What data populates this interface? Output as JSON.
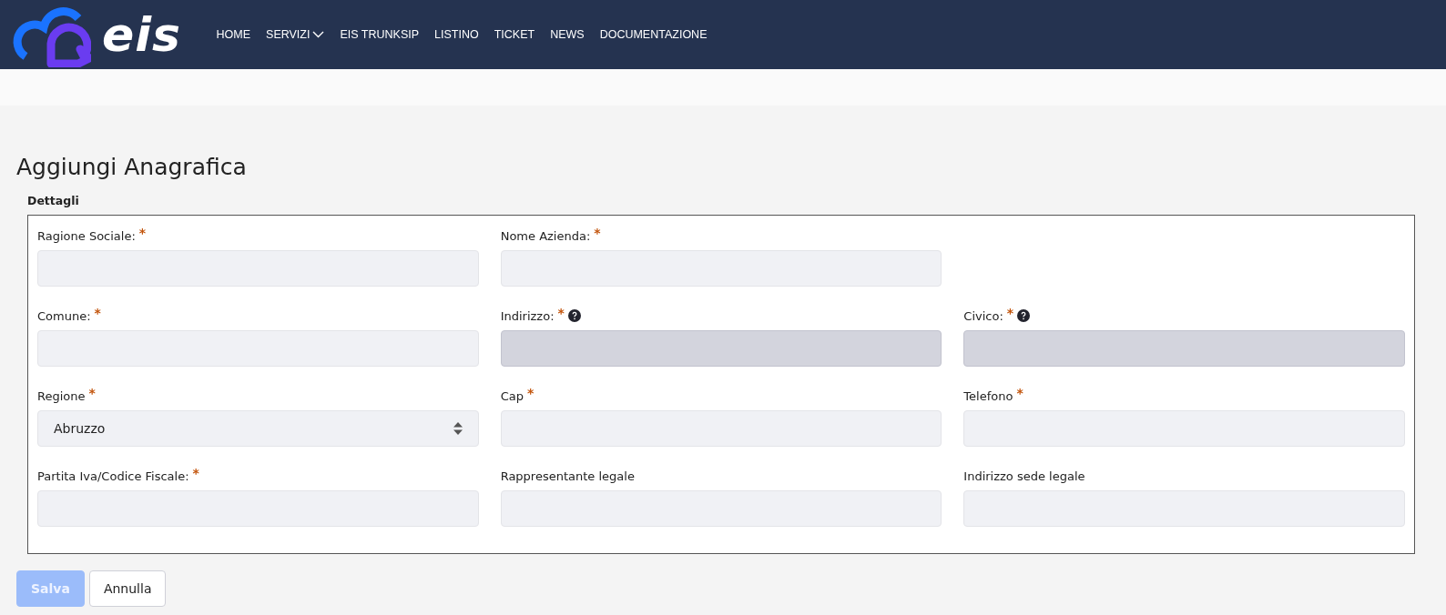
{
  "header": {
    "logo_text": "eis",
    "nav": [
      {
        "label": "HOME",
        "dropdown": false
      },
      {
        "label": "SERVIZI",
        "dropdown": true
      },
      {
        "label": "EIS TRUNKSIP",
        "dropdown": false
      },
      {
        "label": "LISTINO",
        "dropdown": false
      },
      {
        "label": "TICKET",
        "dropdown": false
      },
      {
        "label": "NEWS",
        "dropdown": false
      },
      {
        "label": "DOCUMENTAZIONE",
        "dropdown": false
      }
    ]
  },
  "page_title": "Aggiungi Anagrafica",
  "section_title": "Dettagli",
  "rows": [
    [
      {
        "label": "Ragione Sociale:",
        "required_mark": "*",
        "help": false,
        "disabled": false,
        "kind": "text"
      },
      {
        "label": "Nome Azienda:",
        "required_mark": "*",
        "help": false,
        "disabled": false,
        "kind": "text"
      }
    ],
    [
      {
        "label": "Comune:",
        "required_mark": "*",
        "help": false,
        "disabled": false,
        "kind": "text"
      },
      {
        "label": "Indirizzo:",
        "required_mark": "*",
        "help": true,
        "disabled": true,
        "kind": "text"
      },
      {
        "label": "Civico:",
        "required_mark": "*",
        "help": true,
        "disabled": true,
        "kind": "text"
      }
    ],
    [
      {
        "label": "Regione",
        "required_mark": "*",
        "help": false,
        "disabled": false,
        "kind": "select",
        "value": "Abruzzo"
      },
      {
        "label": "Cap",
        "required_mark": "*",
        "help": false,
        "disabled": false,
        "kind": "text"
      },
      {
        "label": "Telefono",
        "required_mark": "*",
        "help": false,
        "disabled": false,
        "kind": "text"
      }
    ],
    [
      {
        "label": "Partita Iva/Codice Fiscale:",
        "required_mark": "*",
        "help": false,
        "disabled": false,
        "kind": "text"
      },
      {
        "label": "Rappresentante legale",
        "help": false,
        "disabled": false,
        "kind": "text"
      },
      {
        "label": "Indirizzo sede legale",
        "help": false,
        "disabled": false,
        "kind": "text"
      }
    ]
  ],
  "buttons": [
    {
      "label": "Salva",
      "kind": "primary",
      "disabled": true
    },
    {
      "label": "Annulla",
      "kind": "secondary",
      "disabled": false
    }
  ]
}
